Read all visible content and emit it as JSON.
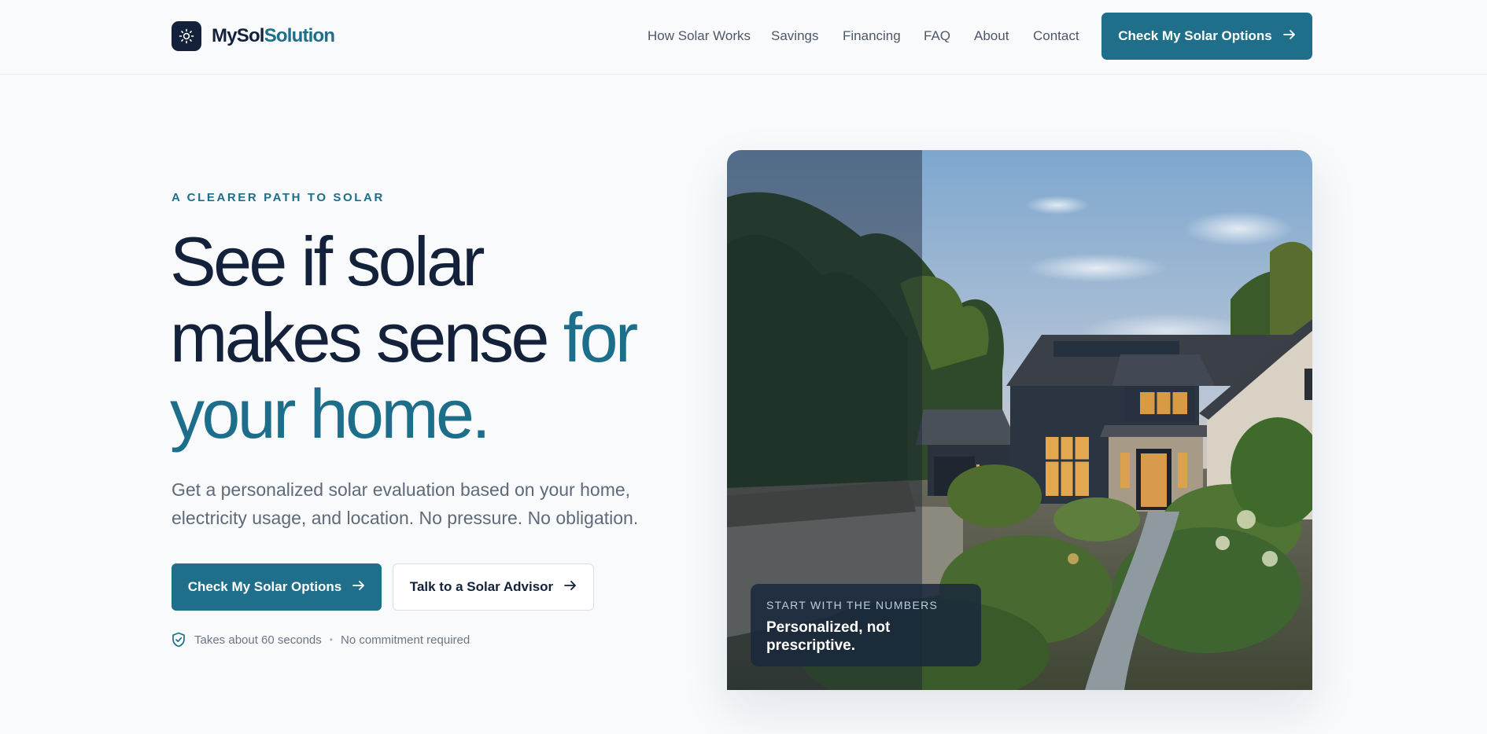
{
  "brand": {
    "name_part1": "MySol",
    "name_part2": "Solution",
    "icon": "sun-icon"
  },
  "nav": {
    "items": [
      {
        "label": "How Solar Works"
      },
      {
        "label": "Savings"
      },
      {
        "label": "Financing"
      },
      {
        "label": "FAQ"
      },
      {
        "label": "About"
      },
      {
        "label": "Contact"
      }
    ],
    "cta_label": "Check My Solar Options",
    "cta_icon": "arrow-right-icon"
  },
  "hero": {
    "eyebrow": "A CLEARER PATH TO SOLAR",
    "title_line1": "See if solar",
    "title_line2": "makes sense ",
    "title_accent1": "for",
    "title_accent2": "your home.",
    "subtitle": "Get a personalized solar evaluation based on your home, electricity usage, and location. No pressure. No obligation.",
    "primary_cta": "Check My Solar Options",
    "secondary_cta": "Talk to a Solar Advisor",
    "reassurance_1": "Takes about 60 seconds",
    "reassurance_separator": "•",
    "reassurance_2": "No commitment required",
    "reassurance_icon": "shield-check-icon"
  },
  "image_card": {
    "caption_eyebrow": "START WITH THE NUMBERS",
    "caption_text": "Personalized, not prescriptive."
  },
  "colors": {
    "background": "#f8fafc",
    "navy": "#13213a",
    "teal_accent": "#1d6e8a",
    "button": "#1f6f8b",
    "muted_text": "#5f6a79"
  }
}
